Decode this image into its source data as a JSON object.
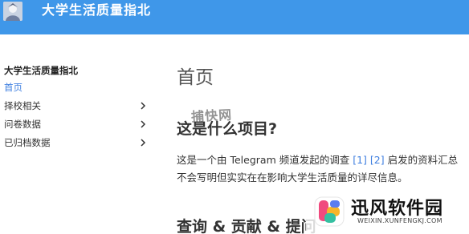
{
  "header": {
    "site_title": "大学生活质量指北"
  },
  "sidebar": {
    "title": "大学生活质量指北",
    "items": [
      {
        "label": "首页",
        "active": true,
        "has_children": false
      },
      {
        "label": "择校相关",
        "active": false,
        "has_children": true
      },
      {
        "label": "问卷数据",
        "active": false,
        "has_children": true
      },
      {
        "label": "已归档数据",
        "active": false,
        "has_children": true
      }
    ]
  },
  "main": {
    "page_title": "首页",
    "section1_heading": "这是什么项目?",
    "intro_prefix": "这是一个由 Telegram 频道发起的调查 ",
    "link1": "[1]",
    "link2": "[2]",
    "intro_suffix": " 启发的资料汇总",
    "intro_line2": "不会写明但实实在在影响大学生活质量的详尽信息。",
    "section2_heading": "查询 & 贡献 & 提问"
  },
  "watermark": {
    "center_text": "捕快网",
    "brand_name": "迅风软件园",
    "brand_domain": "WEIXIN.XUNFENGKJ.COM"
  },
  "colors": {
    "header_bg": "#3f97e9",
    "link": "#3f7fe0"
  }
}
